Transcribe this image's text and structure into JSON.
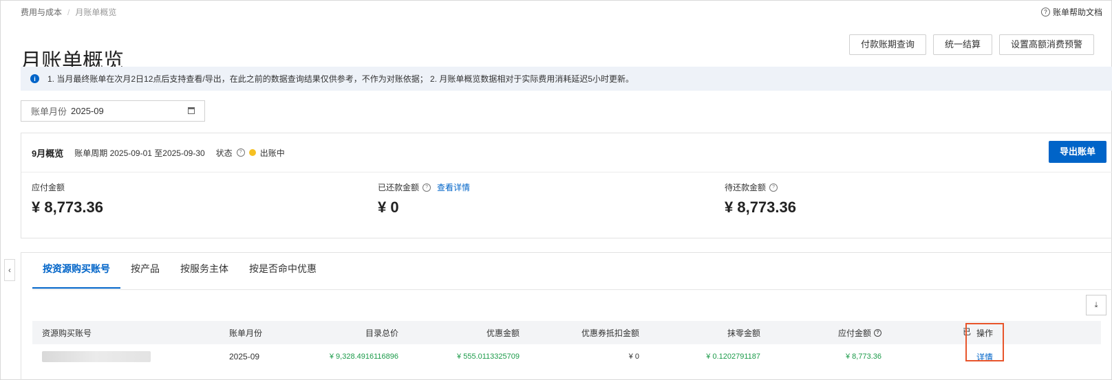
{
  "breadcrumb": {
    "items": [
      "费用与成本",
      "月账单概览"
    ]
  },
  "help": {
    "label": "账单帮助文档"
  },
  "page": {
    "title": "月账单概览"
  },
  "top_buttons": [
    "付款账期查询",
    "统一结算",
    "设置高额消费预警"
  ],
  "notice": {
    "text": "1. 当月最终账单在次月2日12点后支持查看/导出，在此之前的数据查询结果仅供参考，不作为对账依据； 2. 月账单概览数据相对于实际费用消耗延迟5小时更新。"
  },
  "month_select": {
    "label": "账单月份",
    "value": "2025-09"
  },
  "overview": {
    "title": "9月概览",
    "period": "账单周期 2025-09-01 至2025-09-30",
    "status_label": "状态",
    "status_value": "出账中",
    "export_label": "导出账单",
    "payable": {
      "label": "应付金额",
      "value": "¥ 8,773.36"
    },
    "paid": {
      "label": "已还款金额",
      "link": "查看详情",
      "value": "¥ 0"
    },
    "pending": {
      "label": "待还款金额",
      "value": "¥ 8,773.36"
    }
  },
  "tabs": [
    "按资源购买账号",
    "按产品",
    "按服务主体",
    "按是否命中优惠"
  ],
  "table": {
    "headers": [
      "资源购买账号",
      "账单月份",
      "目录总价",
      "优惠金额",
      "优惠券抵扣金额",
      "抹零金额",
      "应付金额",
      "已",
      "操作"
    ],
    "rows": [
      {
        "account": "",
        "month": "2025-09",
        "list_price": "¥ 9,328.4916116896",
        "discount": "¥ 555.0113325709",
        "coupon": "¥ 0",
        "rounding": "¥ 0.1202791187",
        "payable": "¥ 8,773.36",
        "action": "详情"
      }
    ]
  },
  "colors": {
    "primary": "#0064c8",
    "green": "#1a9a48",
    "highlight": "#e8542a",
    "status_dot": "#f6c022"
  }
}
